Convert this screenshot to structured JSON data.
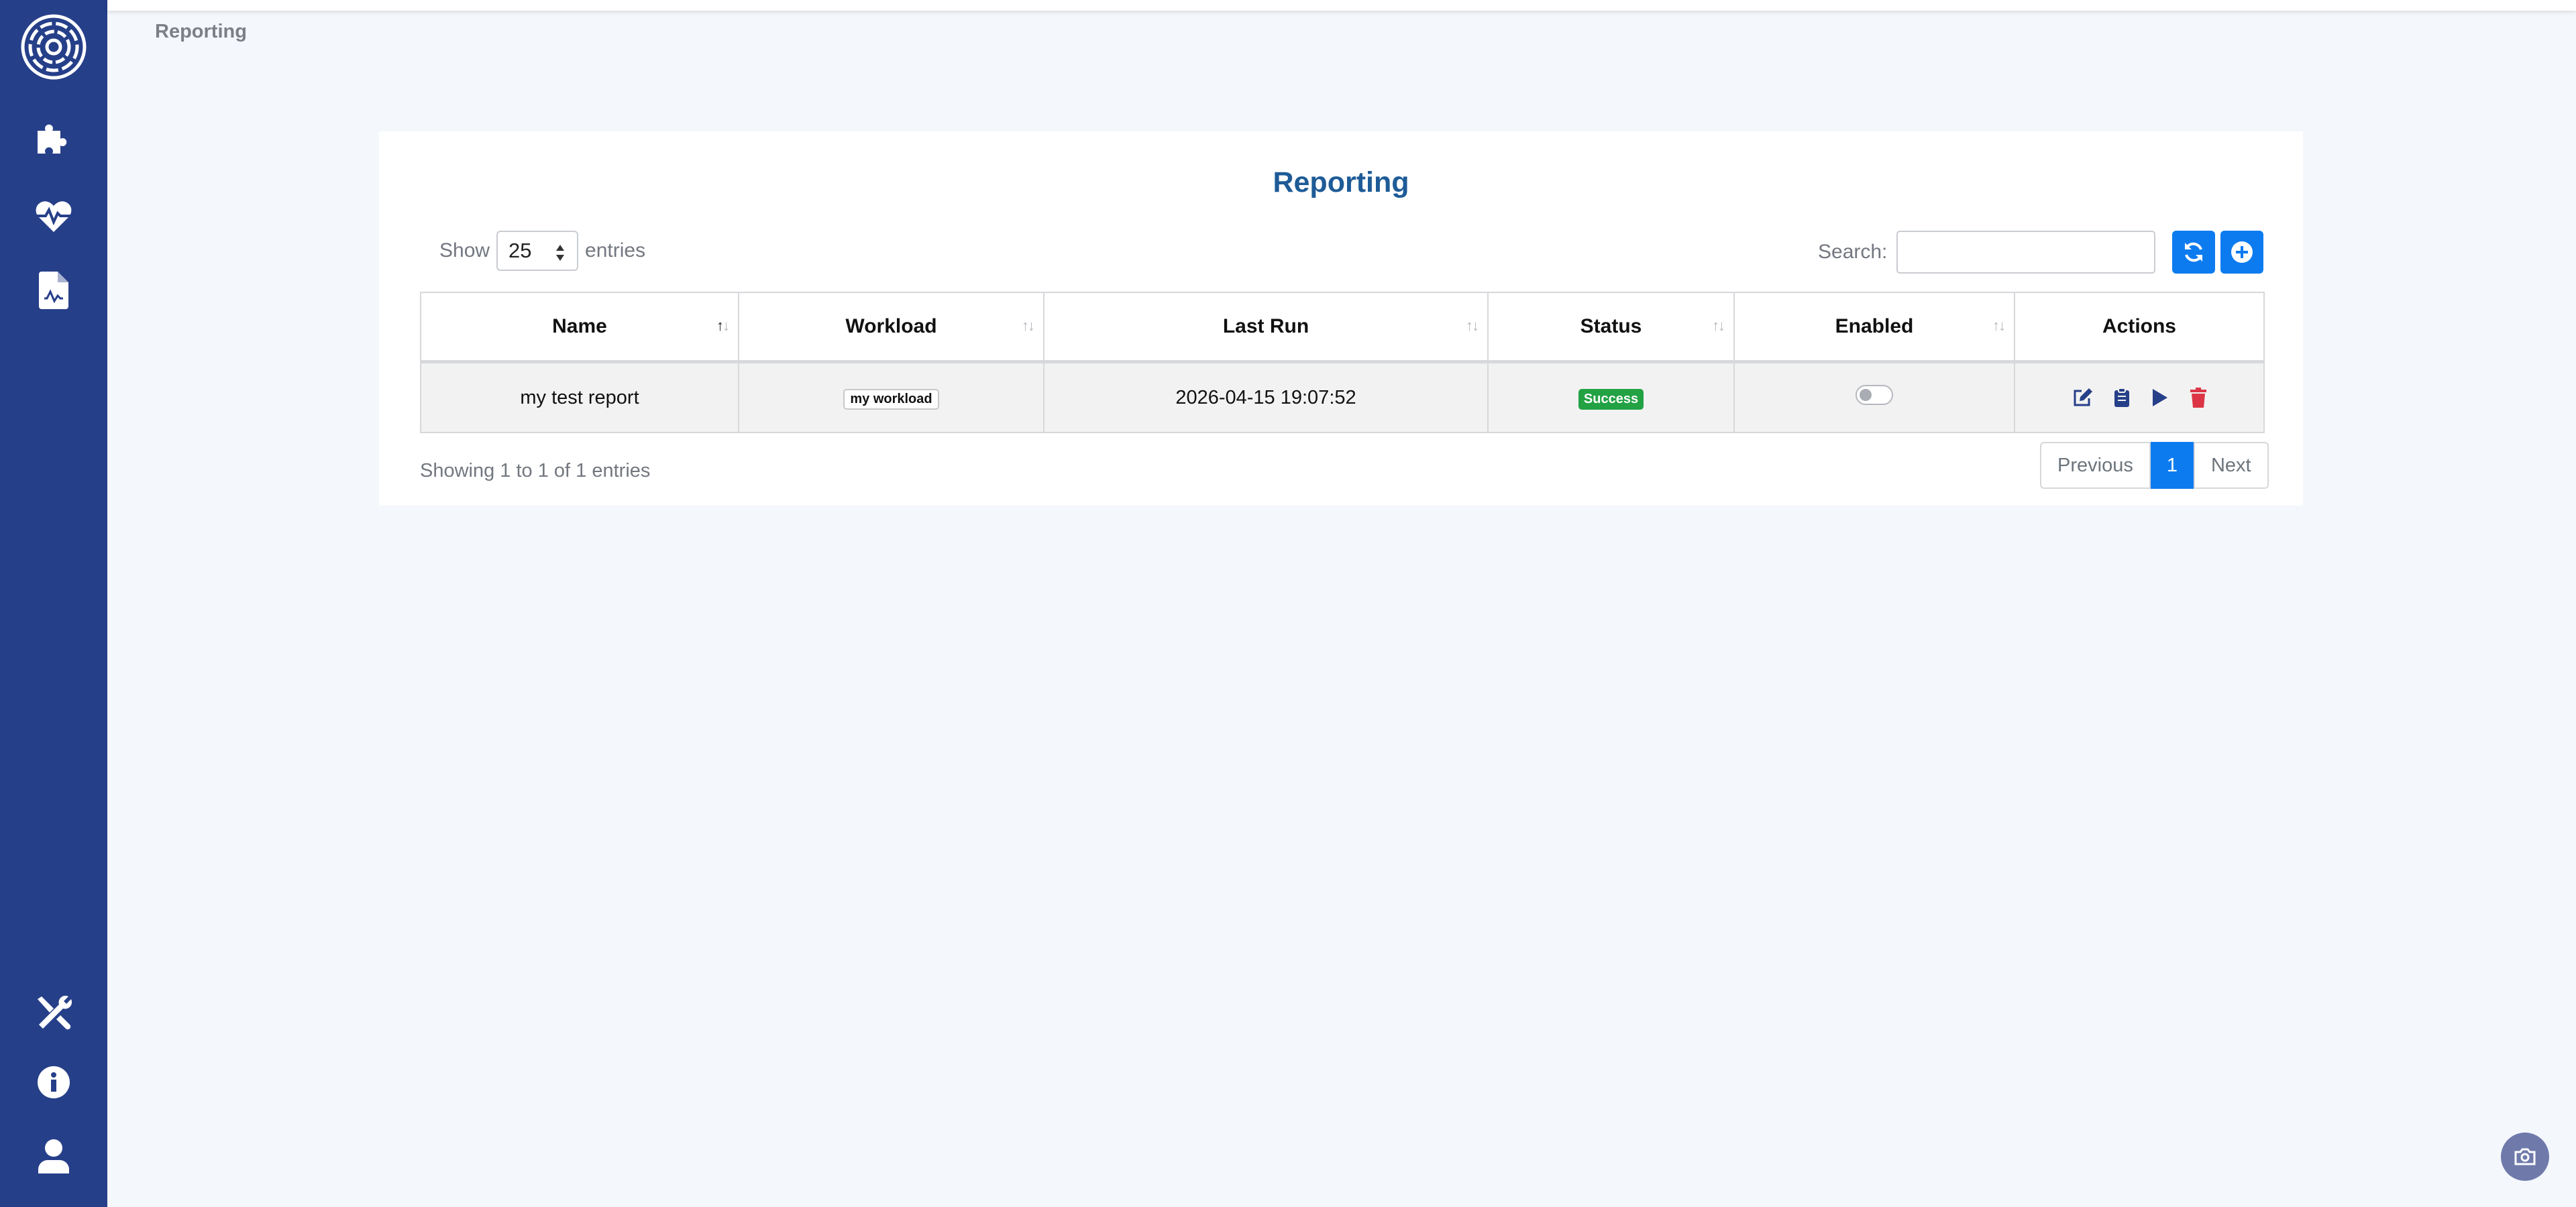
{
  "breadcrumb": "Reporting",
  "card": {
    "title": "Reporting",
    "show_label": "Show",
    "entries_value": "25",
    "entries_label": "entries",
    "search_label": "Search:",
    "search_value": ""
  },
  "table": {
    "columns": [
      "Name",
      "Workload",
      "Last Run",
      "Status",
      "Enabled",
      "Actions"
    ],
    "rows": [
      {
        "name": "my test report",
        "workload": "my workload",
        "last_run": "2026-04-15 19:07:52",
        "status": "Success",
        "enabled": false
      }
    ]
  },
  "footer": {
    "info": "Showing 1 to 1 of 1 entries",
    "prev": "Previous",
    "page": "1",
    "next": "Next"
  },
  "icons": {
    "sidebar": [
      "logo-icon",
      "puzzle-icon",
      "heartbeat-icon",
      "report-file-icon",
      "tools-icon",
      "info-icon",
      "user-icon"
    ],
    "toolbar": [
      "refresh-icon",
      "add-icon"
    ],
    "row_actions": [
      "edit-icon",
      "clipboard-icon",
      "play-icon",
      "trash-icon"
    ],
    "corner": "camera-icon"
  },
  "colors": {
    "sidebar": "#263f89",
    "primary": "#0d7bf0",
    "title": "#1e5b97",
    "success": "#23a244",
    "danger": "#dc3545"
  }
}
